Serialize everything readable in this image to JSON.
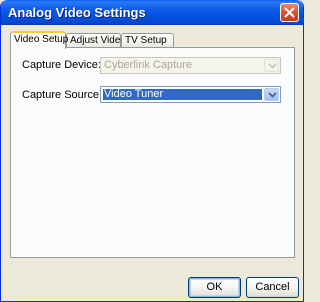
{
  "window": {
    "title": "Analog Video Settings"
  },
  "tabs": [
    {
      "label": "Video Setup",
      "active": true
    },
    {
      "label": "Adjust Video",
      "active": false
    },
    {
      "label": "TV Setup",
      "active": false
    }
  ],
  "form": {
    "capture_device": {
      "label": "Capture Device:",
      "value": "Cyberlink Capture",
      "enabled": false
    },
    "capture_source": {
      "label": "Capture Source:",
      "value": "Video Tuner",
      "enabled": true
    }
  },
  "buttons": {
    "ok": "OK",
    "cancel": "Cancel"
  }
}
